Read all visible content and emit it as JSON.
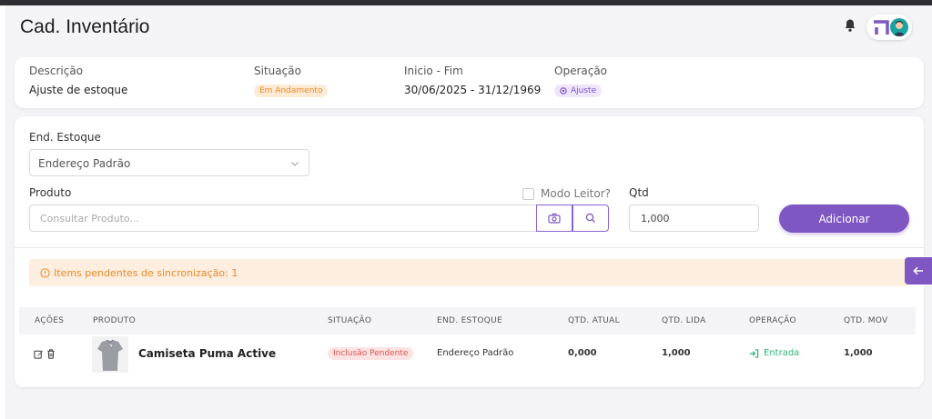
{
  "header": {
    "title": "Cad. Inventário"
  },
  "info": {
    "descricao_label": "Descrição",
    "descricao_value": "Ajuste de estoque",
    "situacao_label": "Situação",
    "situacao_value": "Em Andamento",
    "periodo_label": "Inicio - Fim",
    "periodo_value": "30/06/2025 - 31/12/1969",
    "operacao_label": "Operação",
    "operacao_value": "Ajuste"
  },
  "form": {
    "end_estoque_label": "End. Estoque",
    "end_estoque_value": "Endereço Padrão",
    "produto_label": "Produto",
    "produto_placeholder": "Consultar Produto...",
    "modo_leitor_label": "Modo Leitor?",
    "qtd_label": "Qtd",
    "qtd_value": "1,000",
    "add_label": "Adicionar"
  },
  "alert": {
    "text": "Items pendentes de sincronização: 1"
  },
  "table": {
    "headers": [
      "AÇÕES",
      "PRODUTO",
      "SITUAÇÃO",
      "END. ESTOQUE",
      "QTD. ATUAL",
      "QTD. LIDA",
      "OPERAÇÃO",
      "QTD. MOV"
    ],
    "rows": [
      {
        "produto": "Camiseta Puma Active",
        "situacao": "Inclusão Pendente",
        "end_estoque": "Endereço Padrão",
        "qtd_atual": "0,000",
        "qtd_lida": "1,000",
        "operacao": "Entrada",
        "qtd_mov": "1,000"
      }
    ]
  },
  "colors": {
    "accent": "#7e57c2",
    "orange": "#e98a23",
    "green": "#2bb673",
    "red": "#d9534f"
  },
  "icons": [
    "bell-icon",
    "logo-icon",
    "avatar",
    "chevron-down-icon",
    "camera-icon",
    "search-icon",
    "info-icon",
    "edit-icon",
    "trash-icon",
    "login-icon",
    "arrow-left-icon"
  ]
}
